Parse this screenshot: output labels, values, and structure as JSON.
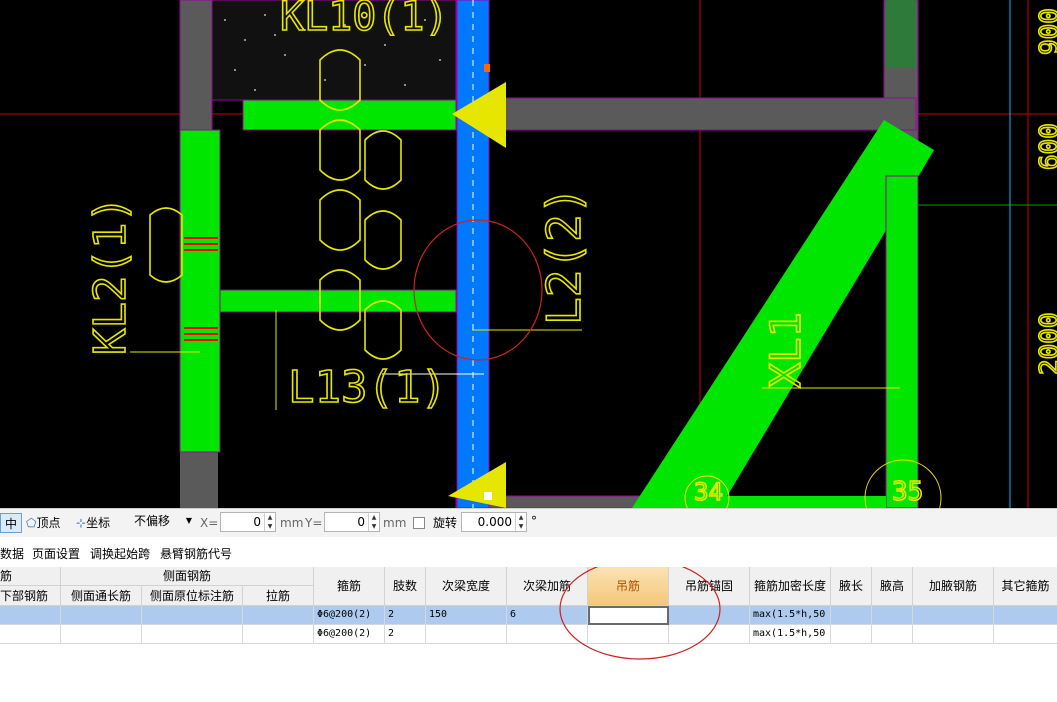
{
  "canvas": {
    "labels": {
      "kl_top": "KL10(1)",
      "kl_left": "KL2(1)",
      "l13": "L13(1)",
      "l2": "L2(2)",
      "xl1": "XL1",
      "axis_34": "34",
      "axis_35": "35",
      "dim_900": "900",
      "dim_600": "600",
      "dim_2000": "2000"
    }
  },
  "snapbar": {
    "midpoint": "中点",
    "vertex": "顶点",
    "coord": "坐标",
    "offset_mode": "不偏移",
    "x_label": "X=",
    "x_value": "0",
    "unit1": "mm",
    "y_label": "Y=",
    "y_value": "0",
    "unit2": "mm",
    "rotate_label": "旋转",
    "rotate_value": "0.000",
    "degree": "°"
  },
  "toolbar": {
    "items": [
      "数据",
      "页面设置",
      "调换起始跨",
      "悬臂钢筋代号"
    ]
  },
  "table": {
    "group_headers": {
      "left": "筋",
      "side": "侧面钢筋"
    },
    "columns": [
      "下部钢筋",
      "侧面通长筋",
      "侧面原位标注筋",
      "拉筋",
      "箍筋",
      "肢数",
      "次梁宽度",
      "次梁加筋",
      "吊筋",
      "吊筋锚固",
      "箍筋加密长度",
      "腋长",
      "腋高",
      "加腋钢筋",
      "其它箍筋"
    ],
    "rows": [
      {
        "stirrup": "Φ6@200(2)",
        "legs": "2",
        "sub_width": "150",
        "sub_add": "6",
        "hanger": "",
        "hanger_anchor": "",
        "dense_len": "max(1.5*h,50"
      },
      {
        "stirrup": "Φ6@200(2)",
        "legs": "2",
        "sub_width": "",
        "sub_add": "",
        "hanger": "",
        "hanger_anchor": "",
        "dense_len": "max(1.5*h,50"
      }
    ]
  },
  "colors": {
    "beam_green": "#00e600",
    "beam_blue": "#0078ff",
    "column_grey": "#5a5a5a",
    "axis_red": "#d00000",
    "text_yellow": "#e6e600",
    "highlight_header": "#f5c77a",
    "selected_row": "#aecbef"
  }
}
